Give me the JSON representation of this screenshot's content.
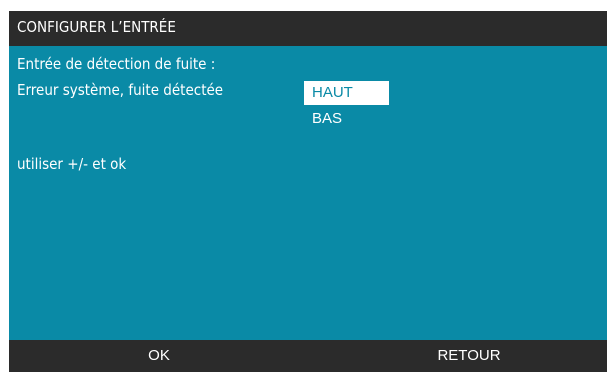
{
  "screen": {
    "title": "CONFIGURER L’ENTRÉE",
    "line1": "Entrée de détection de fuite :",
    "line2": "Erreur système, fuite détectée",
    "hint": "utiliser +/- et ok"
  },
  "options": {
    "items": [
      "HAUT",
      "BAS"
    ],
    "selected": "HAUT"
  },
  "softkeys": {
    "ok": "OK",
    "retour": "RETOUR"
  },
  "colors": {
    "background": "#0a8aa6",
    "bars": "#2b2b2b",
    "text": "#ffffff",
    "selection_bg": "#ffffff",
    "selection_text": "#0a8aa6"
  }
}
